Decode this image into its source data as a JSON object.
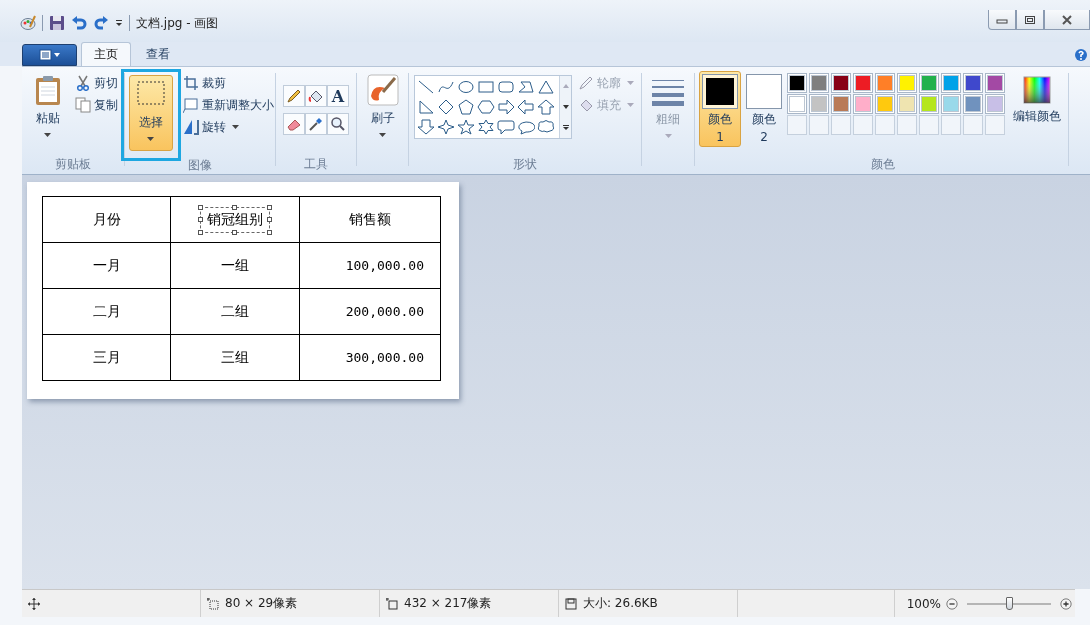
{
  "window": {
    "title": "文档.jpg - 画图"
  },
  "tabs": [
    {
      "label": "主页",
      "selected": true
    },
    {
      "label": "查看",
      "selected": false
    }
  ],
  "ribbon": {
    "clipboard": {
      "label": "剪贴板",
      "paste": "粘贴",
      "cut": "剪切",
      "copy": "复制"
    },
    "image": {
      "label": "图像",
      "select": {
        "label": "选择",
        "selected": true,
        "highlighted": true
      },
      "crop": "裁剪",
      "resize": "重新调整大小",
      "rotate": "旋转"
    },
    "tools": {
      "label": "工具",
      "text_tool": "A"
    },
    "brushes": {
      "label": "刷子"
    },
    "shapes": {
      "label": "形状",
      "outline": {
        "label": "轮廓",
        "disabled": true
      },
      "fill": {
        "label": "填充",
        "disabled": true
      }
    },
    "size": {
      "label": "粗细",
      "disabled": true
    },
    "colors": {
      "label": "颜色",
      "edit": "编辑颜色",
      "active": [
        {
          "label": "颜色 1",
          "color": "#000000",
          "selected": true
        },
        {
          "label": "颜色 2",
          "color": "#ffffff",
          "selected": false
        }
      ],
      "palette": [
        {
          "color": "#000000"
        },
        {
          "color": "#7f7f7f"
        },
        {
          "color": "#880015"
        },
        {
          "color": "#ed1c24"
        },
        {
          "color": "#ff7f27"
        },
        {
          "color": "#fff200"
        },
        {
          "color": "#22b14c"
        },
        {
          "color": "#00a2e8"
        },
        {
          "color": "#3f48cc"
        },
        {
          "color": "#a349a4"
        },
        {
          "color": "#ffffff"
        },
        {
          "color": "#c3c3c3"
        },
        {
          "color": "#b97a57"
        },
        {
          "color": "#ffaec9"
        },
        {
          "color": "#ffc90e"
        },
        {
          "color": "#efe4b0"
        },
        {
          "color": "#b5e61d"
        },
        {
          "color": "#99d9ea"
        },
        {
          "color": "#7092be"
        },
        {
          "color": "#c8bfe7"
        }
      ]
    }
  },
  "canvas": {
    "table": {
      "columns": [
        {
          "label": "月份",
          "selected": false
        },
        {
          "label": "销冠组别",
          "selected": true
        },
        {
          "label": "销售额",
          "selected": false
        }
      ],
      "rows": [
        [
          "一月",
          "一组",
          "100,000.00"
        ],
        [
          "二月",
          "二组",
          "200,000.00"
        ],
        [
          "三月",
          "三组",
          "300,000.00"
        ]
      ]
    }
  },
  "status_bar": {
    "selection_size": "80 × 29像素",
    "image_size": "432 × 217像素",
    "file_size": "大小: 26.6KB",
    "zoom": "100%",
    "zoom_slider": {
      "level": 0.5
    }
  }
}
